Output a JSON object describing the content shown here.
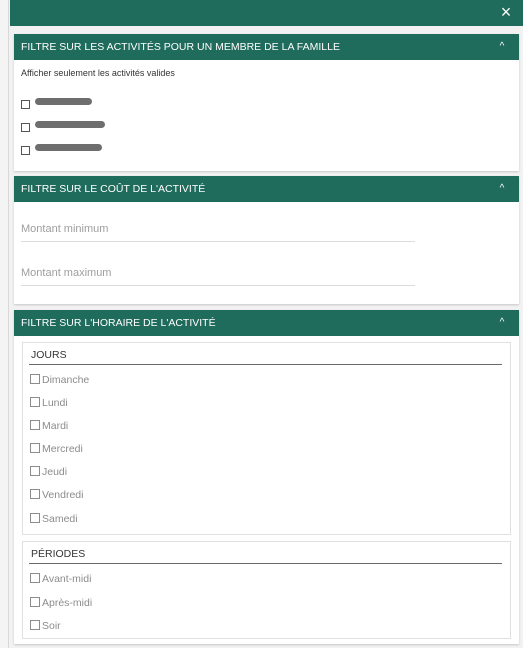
{
  "window": {
    "close_label": "×"
  },
  "family_section": {
    "title": "FILTRE SUR LES ACTIVITÉS POUR UN MEMBRE DE LA FAMILLE",
    "valid_only_label": "Afficher seulement les activités valides"
  },
  "cost_section": {
    "title": "FILTRE SUR LE COÛT DE L'ACTIVITÉ",
    "min_placeholder": "Montant minimum",
    "max_placeholder": "Montant maximum"
  },
  "schedule_section": {
    "title": "FILTRE SUR L'HORAIRE DE L'ACTIVITÉ",
    "days": {
      "title": "JOURS",
      "items": [
        "Dimanche",
        "Lundi",
        "Mardi",
        "Mercredi",
        "Jeudi",
        "Vendredi",
        "Samedi"
      ]
    },
    "periods": {
      "title": "PÉRIODES",
      "items": [
        "Avant-midi",
        "Après-midi",
        "Soir"
      ]
    }
  },
  "icons": {
    "collapse": "chevron-up-icon",
    "close": "close-icon"
  },
  "colors": {
    "header": "#1f6b5c"
  }
}
